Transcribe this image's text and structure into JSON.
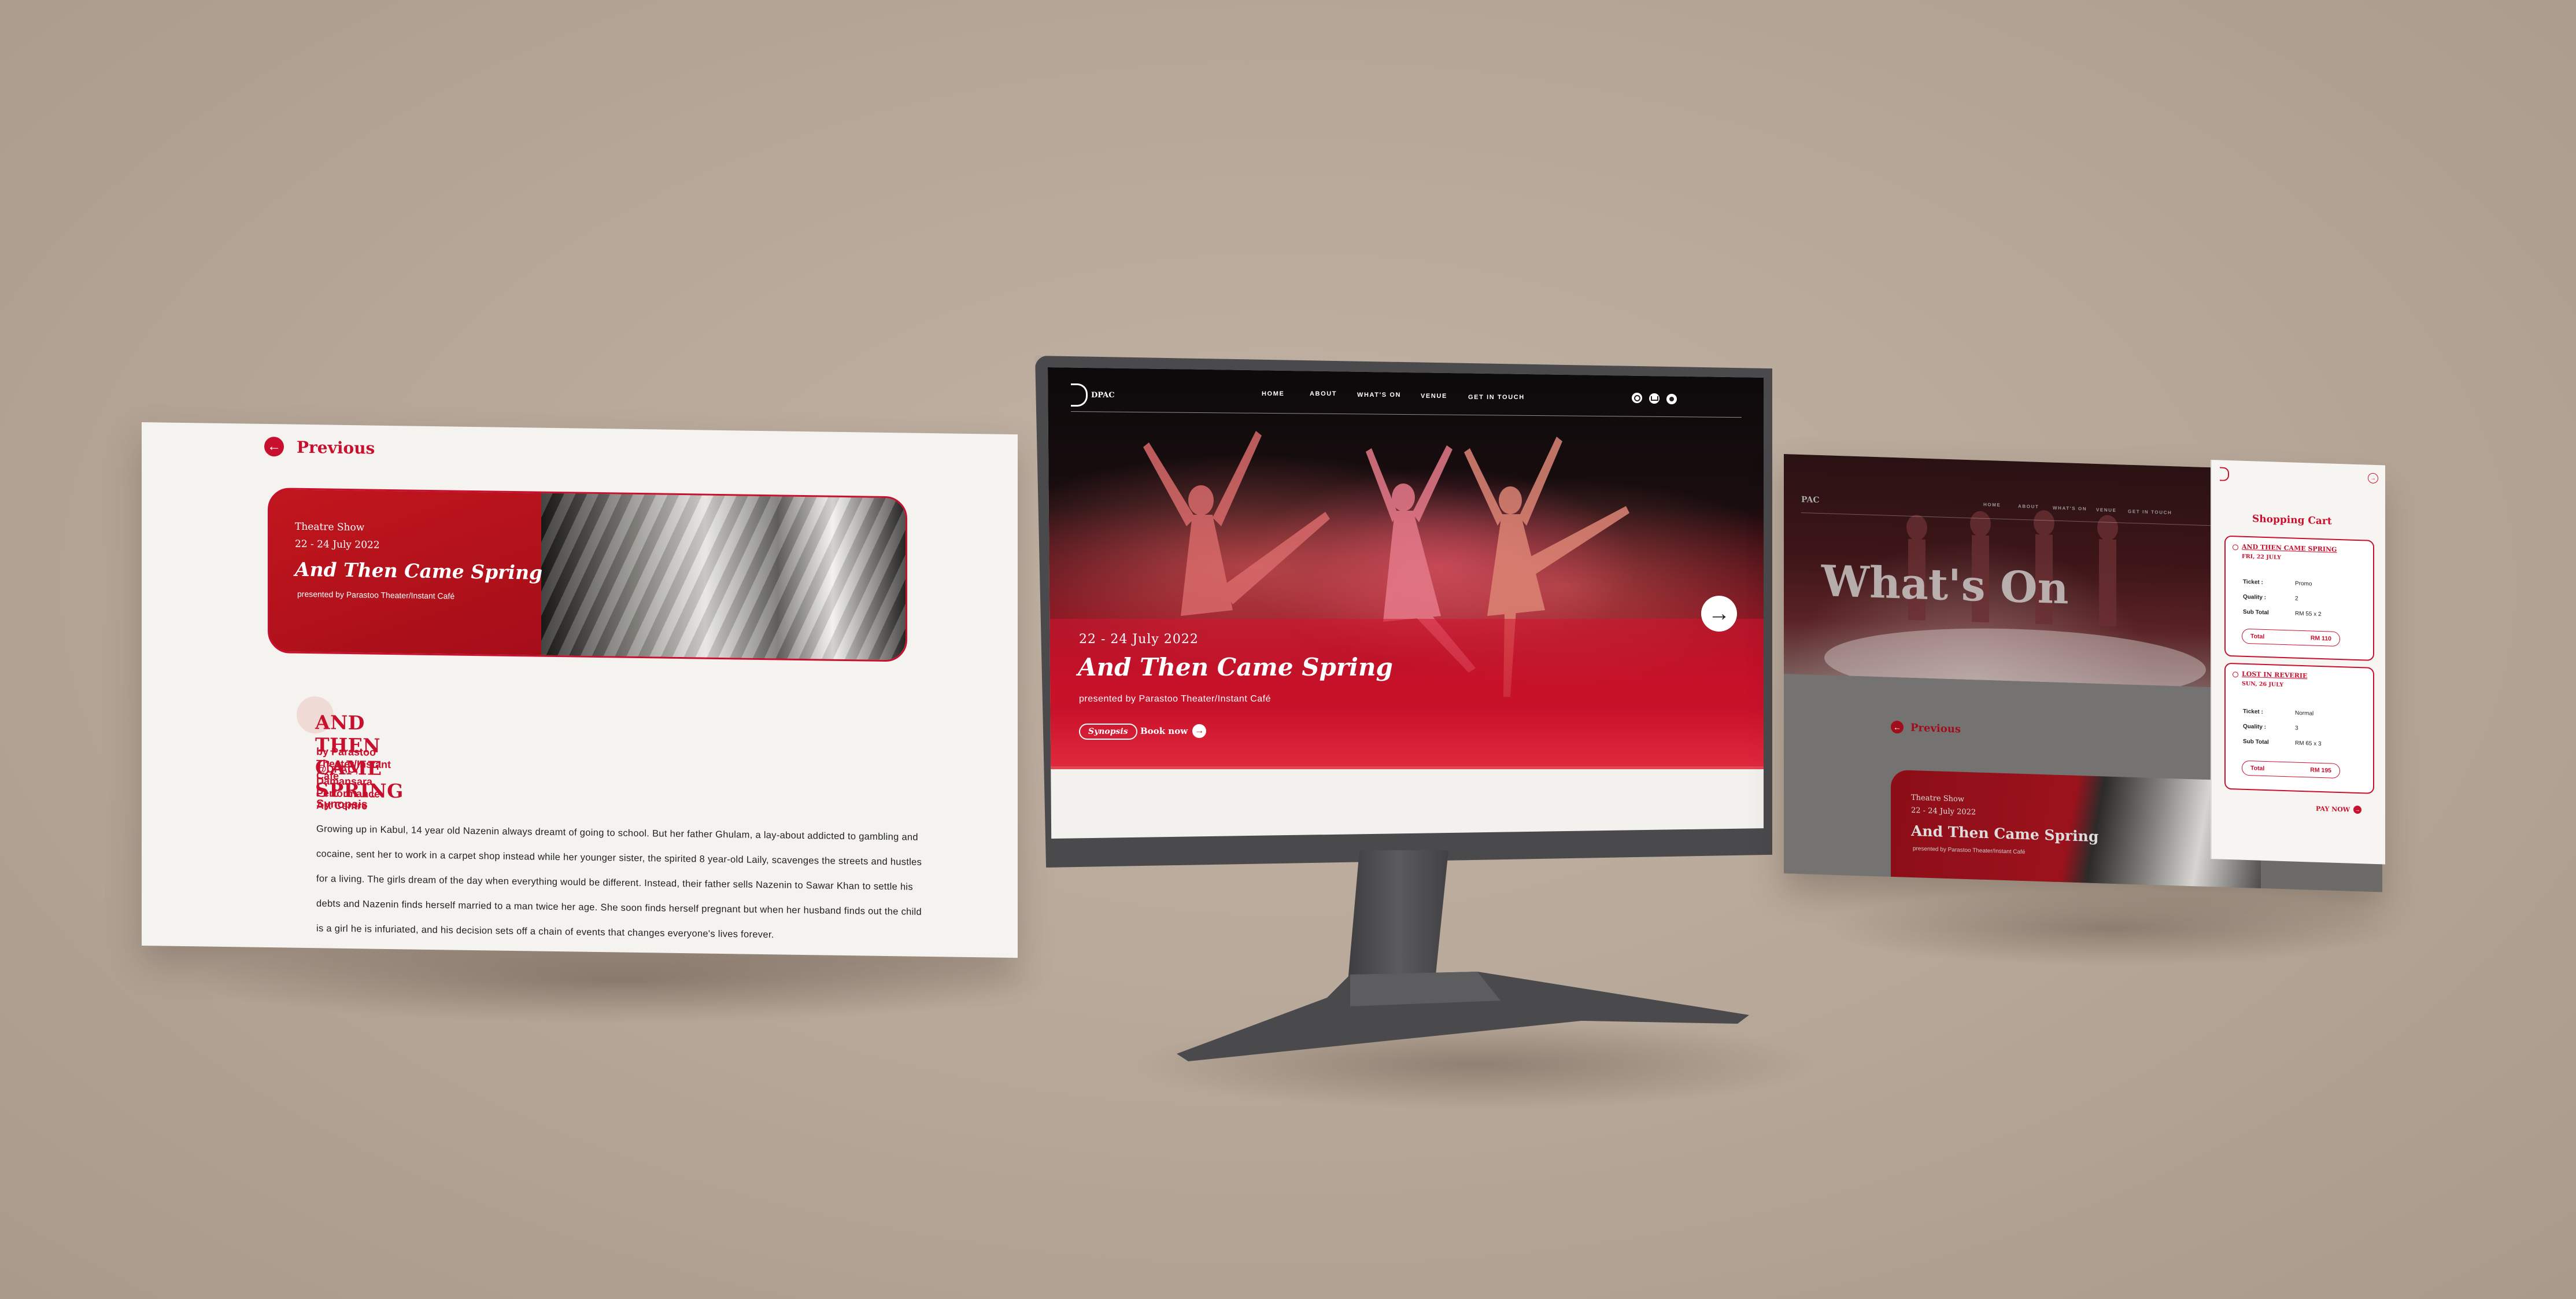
{
  "left_page": {
    "previous_label": "Previous",
    "card": {
      "category": "Theatre Show",
      "dates": "22 - 24 July 2022",
      "title": "And Then Came Spring",
      "presenter": "presented by Parastoo Theater/Instant Café"
    },
    "detail": {
      "title": "AND THEN CAME SPRING",
      "by_line": "by Parastoo Theater/Instant Cafe",
      "venue_line": "@DPAC, Damansara Performance Art Centre",
      "synopsis_heading": "Synopsis",
      "synopsis_lines": [
        "Growing up in Kabul, 14 year old Nazenin always dreamt of going to school. But her father Ghulam, a lay-about addicted to gambling and",
        "cocaine, sent her to work in a carpet shop instead while her younger sister, the spirited 8 year-old Laily, scavenges the streets and hustles",
        "for a living. The girls dream of the day when everything would be different. Instead, their father sells Nazenin to Sawar Khan to settle his",
        "debts and Nazenin finds herself married to a man twice her age. She soon finds herself pregnant but when her husband finds out the child",
        "is a girl he is infuriated, and his decision sets off a chain of events that changes everyone's lives forever."
      ]
    }
  },
  "monitor_page": {
    "logo": "DPAC",
    "nav": [
      "HOME",
      "ABOUT",
      "WHAT'S ON",
      "VENUE",
      "GET IN TOUCH"
    ],
    "hero": {
      "dates": "22 - 24 July 2022",
      "title": "And Then Came Spring",
      "presenter": "presented by Parastoo Theater/Instant Café",
      "synopsis_label": "Synopsis",
      "book_label": "Book now"
    }
  },
  "right_page": {
    "logo": "PAC",
    "nav": [
      "HOME",
      "ABOUT",
      "WHAT'S ON",
      "VENUE",
      "GET IN TOUCH"
    ],
    "hero_title": "What's On",
    "previous_label": "Previous",
    "card": {
      "category": "Theatre Show",
      "dates": "22 - 24 July 2022",
      "title": "And Then Came Spring",
      "presenter": "presented by Parastoo Theater/Instant Café"
    },
    "cart": {
      "title": "Shopping Cart",
      "items": [
        {
          "name": "AND THEN CAME SPRING",
          "date": "FRI, 22 JULY",
          "ticket_label": "Ticket :",
          "ticket_value": "Promo",
          "quality_label": "Quality :",
          "quality_value": "2",
          "subtotal_label": "Sub Total",
          "subtotal_value": "RM 55 x 2",
          "total_label": "Total",
          "total_value": "RM 110"
        },
        {
          "name": "LOST IN REVERIE",
          "date": "SUN, 26 JULY",
          "ticket_label": "Ticket :",
          "ticket_value": "Normal",
          "quality_label": "Quality :",
          "quality_value": "3",
          "subtotal_label": "Sub Total",
          "subtotal_value": "RM 65 x 3",
          "total_label": "Total",
          "total_value": "RM 195"
        }
      ],
      "pay_now_label": "PAY NOW"
    }
  },
  "colors": {
    "accent": "#c8102e",
    "background": "#b6a697",
    "panel": "#f5f3ef"
  }
}
